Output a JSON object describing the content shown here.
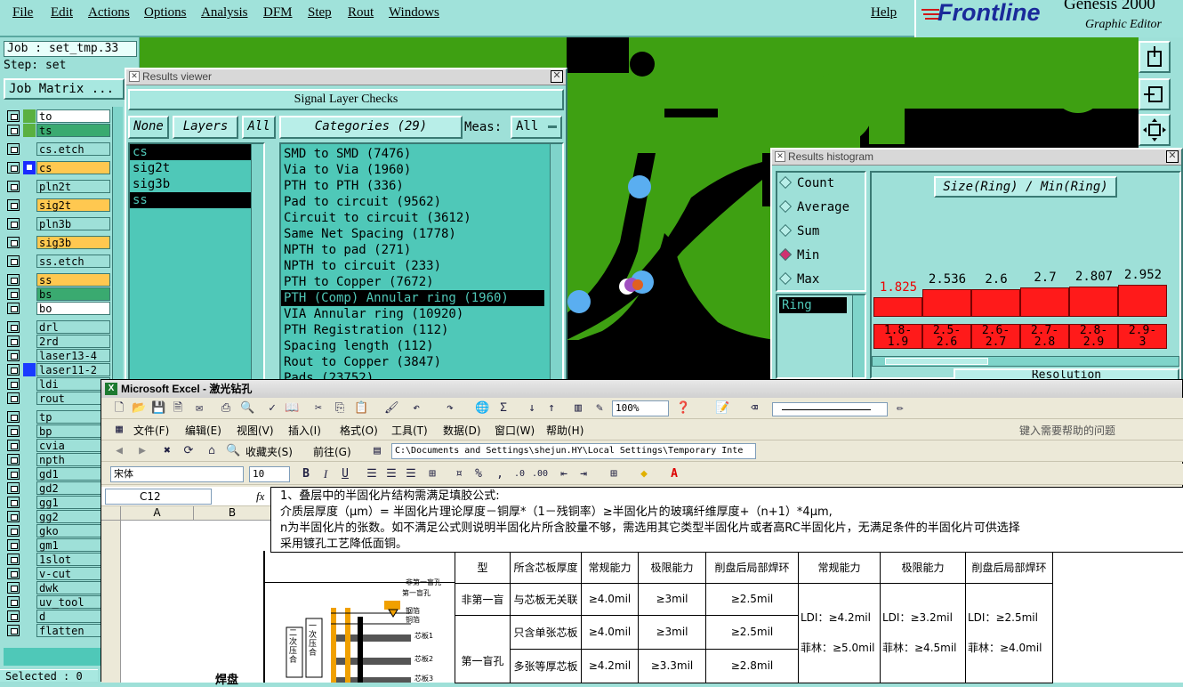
{
  "menu": [
    "File",
    "Edit",
    "Actions",
    "Options",
    "Analysis",
    "DFM",
    "Step",
    "Rout",
    "Windows"
  ],
  "help": "Help",
  "brand": {
    "logo": "Frontline",
    "product": "Genesis 2000",
    "subtitle": "Graphic Editor"
  },
  "job": "Job : set_tmp.33",
  "step": "Step: set",
  "job_matrix": "Job Matrix ...",
  "layers": [
    {
      "name": "to",
      "color": "#ffffff",
      "swatch": "#5ab040"
    },
    {
      "name": "ts",
      "color": "#3aaa70",
      "swatch": "#5ab040"
    },
    {
      "name": "cs.etch",
      "color": "#9ee0d8",
      "swatch": "#9ee0d8"
    },
    {
      "name": "cs",
      "color": "#ffc850",
      "swatch": "#5ab040",
      "sel": true
    },
    {
      "name": "pln2t",
      "color": "#9ee0d8",
      "swatch": "#9ee0d8"
    },
    {
      "name": "sig2t",
      "color": "#ffc850",
      "swatch": "#9ee0d8"
    },
    {
      "name": "pln3b",
      "color": "#9ee0d8",
      "swatch": "#9ee0d8"
    },
    {
      "name": "sig3b",
      "color": "#ffc850",
      "swatch": "#9ee0d8"
    },
    {
      "name": "ss.etch",
      "color": "#9ee0d8",
      "swatch": "#9ee0d8"
    },
    {
      "name": "ss",
      "color": "#ffc850",
      "swatch": "#9ee0d8"
    },
    {
      "name": "bs",
      "color": "#3aaa70",
      "swatch": "#9ee0d8"
    },
    {
      "name": "bo",
      "color": "#ffffff",
      "swatch": "#9ee0d8"
    },
    {
      "name": "drl",
      "color": "#9ee0d8",
      "swatch": "#9ee0d8"
    },
    {
      "name": "2rd",
      "color": "#9ee0d8",
      "swatch": "#9ee0d8"
    },
    {
      "name": "laser13-4",
      "color": "#9ee0d8",
      "swatch": "#9ee0d8"
    },
    {
      "name": "laser11-2",
      "color": "#9ee0d8",
      "swatch": "#1a3aff"
    },
    {
      "name": "ldi",
      "color": "#9ee0d8",
      "swatch": "#9ee0d8"
    },
    {
      "name": "rout",
      "color": "#9ee0d8",
      "swatch": "#9ee0d8"
    },
    {
      "name": "tp",
      "color": "#9ee0d8",
      "swatch": "#9ee0d8"
    },
    {
      "name": "bp",
      "color": "#9ee0d8",
      "swatch": "#9ee0d8"
    },
    {
      "name": "cvia",
      "color": "#9ee0d8",
      "swatch": "#9ee0d8"
    },
    {
      "name": "npth",
      "color": "#9ee0d8",
      "swatch": "#9ee0d8"
    },
    {
      "name": "gd1",
      "color": "#9ee0d8",
      "swatch": "#9ee0d8"
    },
    {
      "name": "gd2",
      "color": "#9ee0d8",
      "swatch": "#9ee0d8"
    },
    {
      "name": "gg1",
      "color": "#9ee0d8",
      "swatch": "#9ee0d8"
    },
    {
      "name": "gg2",
      "color": "#9ee0d8",
      "swatch": "#9ee0d8"
    },
    {
      "name": "gko",
      "color": "#9ee0d8",
      "swatch": "#9ee0d8"
    },
    {
      "name": "gm1",
      "color": "#9ee0d8",
      "swatch": "#9ee0d8"
    },
    {
      "name": "1slot",
      "color": "#9ee0d8",
      "swatch": "#9ee0d8"
    },
    {
      "name": "v-cut",
      "color": "#9ee0d8",
      "swatch": "#9ee0d8"
    },
    {
      "name": "dwk",
      "color": "#9ee0d8",
      "swatch": "#9ee0d8"
    },
    {
      "name": "uv_tool",
      "color": "#9ee0d8",
      "swatch": "#9ee0d8"
    },
    {
      "name": "d",
      "color": "#9ee0d8",
      "swatch": "#9ee0d8"
    },
    {
      "name": "flatten",
      "color": "#9ee0d8",
      "swatch": "#9ee0d8"
    }
  ],
  "selected": "Selected : 0",
  "results_viewer": {
    "title": "Results viewer",
    "header": "Signal Layer Checks",
    "none_btn": "None",
    "layers_btn": "Layers",
    "all_btn": "All",
    "categories_btn": "Categories (29)",
    "meas_label": "Meas:",
    "meas_value": "All",
    "layers": [
      {
        "name": "cs",
        "sel": true
      },
      {
        "name": "sig2t",
        "sel": false
      },
      {
        "name": "sig3b",
        "sel": false
      },
      {
        "name": "ss",
        "sel": true
      }
    ],
    "categories": [
      {
        "name": "SMD to SMD (7476)",
        "sel": false
      },
      {
        "name": "Via to Via (1960)",
        "sel": false
      },
      {
        "name": "PTH to PTH (336)",
        "sel": false
      },
      {
        "name": "Pad to circuit (9562)",
        "sel": false
      },
      {
        "name": "Circuit to circuit (3612)",
        "sel": false
      },
      {
        "name": "Same Net Spacing (1778)",
        "sel": false
      },
      {
        "name": "NPTH to pad (271)",
        "sel": false
      },
      {
        "name": "NPTH to circuit (233)",
        "sel": false
      },
      {
        "name": "PTH to Copper (7672)",
        "sel": false
      },
      {
        "name": "PTH (Comp) Annular ring (1960)",
        "sel": true
      },
      {
        "name": "VIA Annular ring (10920)",
        "sel": false
      },
      {
        "name": "PTH Registration (112)",
        "sel": false
      },
      {
        "name": "Spacing length (112)",
        "sel": false
      },
      {
        "name": "Rout to Copper (3847)",
        "sel": false
      },
      {
        "name": "Pads (23752)",
        "sel": false
      }
    ]
  },
  "histogram": {
    "title": "Results histogram",
    "modes": [
      {
        "name": "Count",
        "on": false
      },
      {
        "name": "Average",
        "on": false
      },
      {
        "name": "Sum",
        "on": false
      },
      {
        "name": "Min",
        "on": true
      },
      {
        "name": "Max",
        "on": false
      }
    ],
    "field": "Ring",
    "chart_title": "Size(Ring) / Min(Ring)",
    "resolution": "Resolution",
    "bars": [
      {
        "value": "1.825",
        "range": "1.8-\n1.9",
        "red": true
      },
      {
        "value": "2.536",
        "range": "2.5-\n2.6",
        "red": false
      },
      {
        "value": "2.6",
        "range": "2.6-\n2.7",
        "red": false
      },
      {
        "value": "2.7",
        "range": "2.7-\n2.8",
        "red": false
      },
      {
        "value": "2.807",
        "range": "2.8-\n2.9",
        "red": false
      },
      {
        "value": "2.952",
        "range": "2.9-\n3",
        "red": false
      }
    ]
  },
  "excel": {
    "title": "Microsoft Excel - 激光钻孔",
    "menus": [
      "文件(F)",
      "编辑(E)",
      "视图(V)",
      "插入(I)",
      "格式(O)",
      "工具(T)",
      "数据(D)",
      "窗口(W)",
      "帮助(H)"
    ],
    "help_placeholder": "键入需要帮助的问题",
    "zoom": "100%",
    "fav_label": "收藏夹(S)",
    "go_label": "前往(G)",
    "path": "C:\\Documents and Settings\\shejun.HY\\Local Settings\\Temporary Inte",
    "font": "宋体",
    "font_size": "10",
    "name_box": "C12",
    "fx": "fx",
    "formula_lines": [
      "1、叠层中的半固化片结构需满足填胶公式:",
      "介质层厚度（μm）= 半固化片理论厚度－铜厚*（1－残铜率）≥半固化片的玻璃纤维厚度+（n+1）*4μm,",
      "n为半固化片的张数。如不满足公式则说明半固化片所含胶量不够，需选用其它类型半固化片或者高RC半固化片，无满足条件的半固化片可供选择",
      "采用镀孔工艺降低面铜。"
    ],
    "col_a": "A",
    "col_b": "B",
    "header_row": [
      "型",
      "所含芯板厚度",
      "常规能力",
      "极限能力",
      "削盘后局部焊环",
      "常规能力",
      "极限能力",
      "削盘后局部焊环"
    ],
    "rows": [
      [
        "非第一盲",
        "与芯板无关联",
        "≥4.0mil",
        "≥3mil",
        "≥2.5mil"
      ],
      [
        "",
        "只含单张芯板",
        "≥4.0mil",
        "≥3mil",
        "≥2.5mil"
      ],
      [
        "第一盲孔",
        "多张等厚芯板",
        "≥4.2mil",
        "≥3.3mil",
        "≥2.8mil"
      ]
    ],
    "ldi": [
      "LDI：≥4.2mil",
      "LDI：≥3.2mil",
      "LDI：≥2.5mil"
    ],
    "film": [
      "菲林：≥5.0mil",
      "菲林：≥4.5mil",
      "菲林：≥4.0mil"
    ],
    "diagram_labels": [
      "非第一盲孔",
      "第一盲孔",
      "钢箔",
      "铜箔",
      "芯板1",
      "芯板2",
      "芯板3",
      "二次压合",
      "一次压合"
    ],
    "cell_b": "焊盘"
  }
}
